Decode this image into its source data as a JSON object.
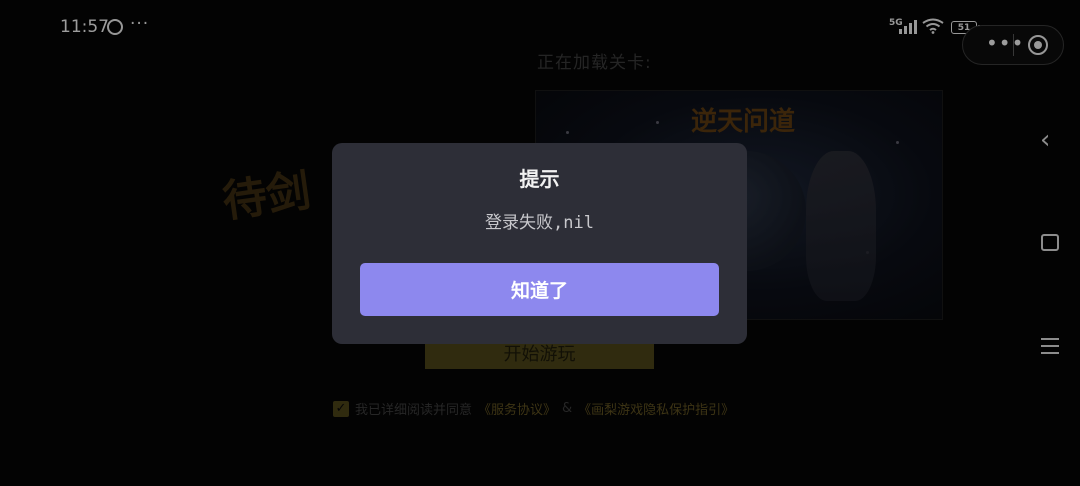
{
  "status_bar": {
    "time": "11:57",
    "app_icon": "tiktok-icon",
    "more": "···",
    "network": "5G",
    "battery": "51"
  },
  "capsule": {
    "more_icon": "more-dots-icon",
    "close_icon": "close-circle-icon"
  },
  "nav": {
    "back_icon": "back-chevron-icon",
    "home_icon": "home-square-icon",
    "menu_icon": "menu-icon"
  },
  "background": {
    "loading_label": "正在加载关卡:",
    "preview_title": "逆天问道",
    "logo_text": "待剑",
    "start_button": "开始游玩",
    "agreement": {
      "prefix": "我已详细阅读并同意",
      "service_link": "《服务协议》",
      "ampersand": "&",
      "privacy_link": "《画梨游戏隐私保护指引》"
    }
  },
  "dialog": {
    "title": "提示",
    "message": "登录失败,nil",
    "confirm_label": "知道了"
  },
  "colors": {
    "dialog_bg": "#2d2e37",
    "accent": "#8d88ee"
  }
}
